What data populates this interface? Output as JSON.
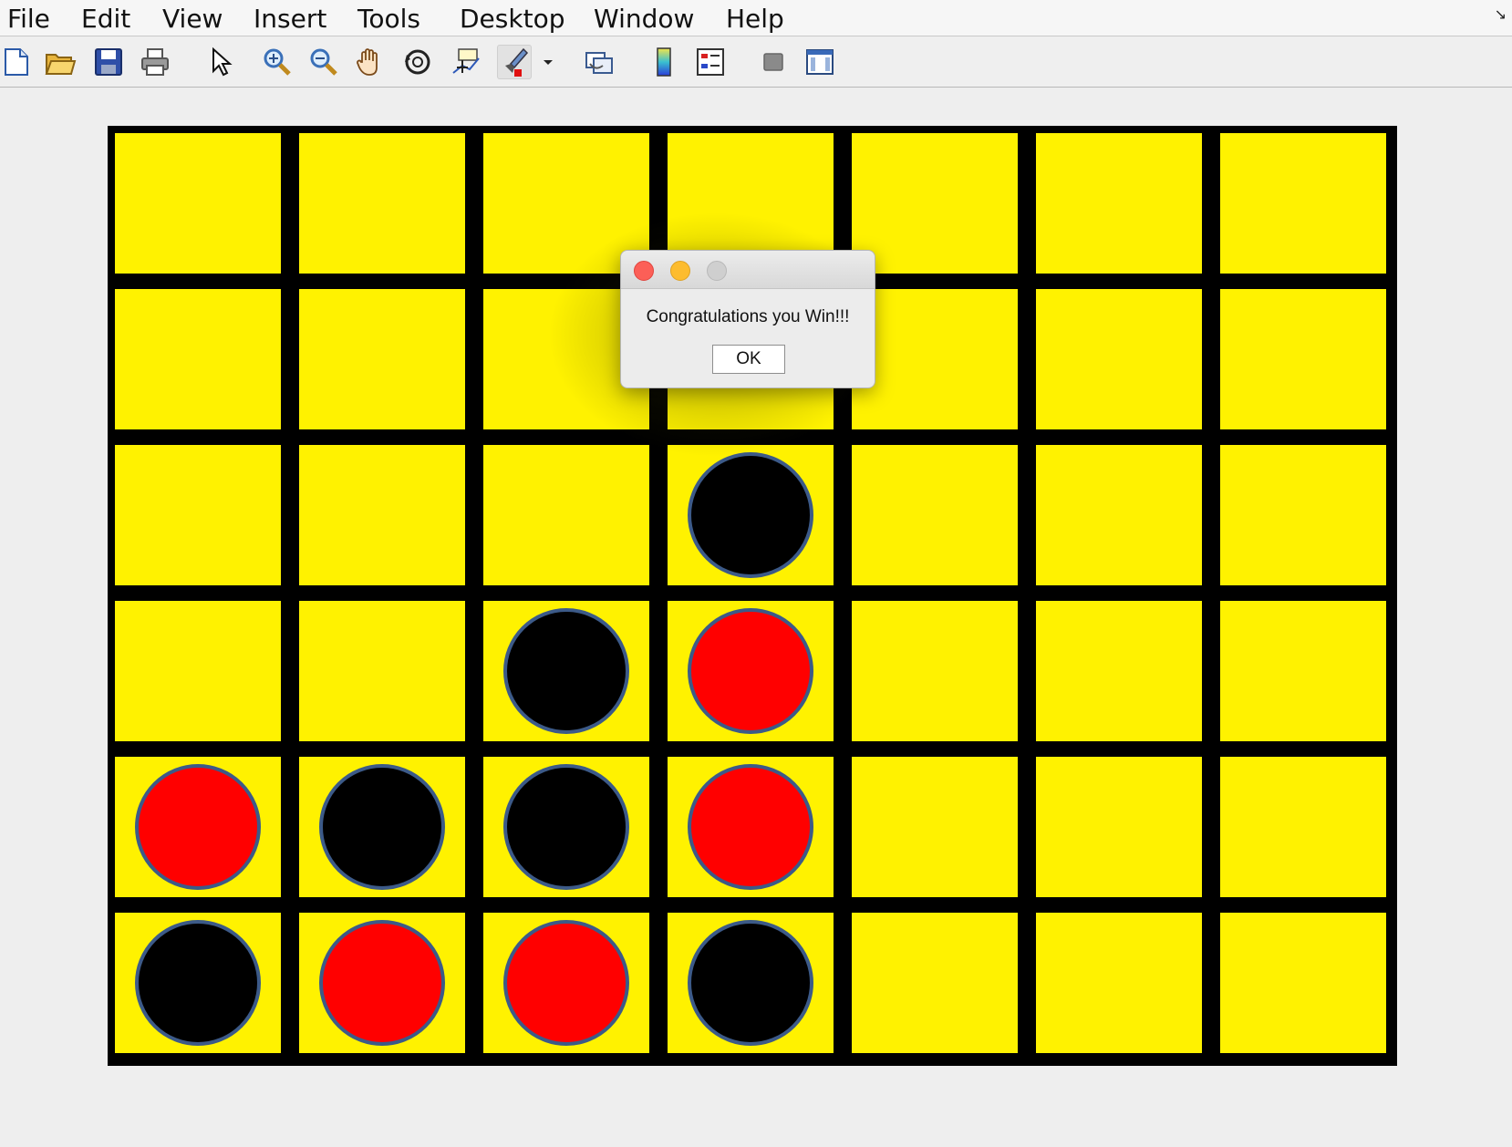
{
  "menu": {
    "items": [
      {
        "id": "file",
        "label": "File"
      },
      {
        "id": "edit",
        "label": "Edit"
      },
      {
        "id": "view",
        "label": "View"
      },
      {
        "id": "insert",
        "label": "Insert"
      },
      {
        "id": "tools",
        "label": "Tools"
      },
      {
        "id": "desktop",
        "label": "Desktop"
      },
      {
        "id": "window",
        "label": "Window"
      },
      {
        "id": "help",
        "label": "Help"
      }
    ]
  },
  "toolbar": {
    "icons": [
      "new-figure-icon",
      "open-file-icon",
      "save-icon",
      "print-icon",
      "edit-plot-arrow-icon",
      "zoom-in-icon",
      "zoom-out-icon",
      "pan-hand-icon",
      "rotate-3d-icon",
      "data-cursor-icon",
      "brush-icon",
      "brush-dropdown-icon",
      "link-plot-icon",
      "insert-colorbar-icon",
      "insert-legend-icon",
      "hide-plot-tools-icon",
      "show-plot-tools-icon"
    ]
  },
  "colors": {
    "board_frame": "#000000",
    "cell_yellow": "#fff200",
    "red_disc": "#ff0000",
    "black_disc": "#000000",
    "disc_outline": "#3c5a88"
  },
  "board": {
    "rows": 6,
    "cols": 7,
    "grid": [
      [
        "",
        "",
        "",
        "",
        "",
        "",
        ""
      ],
      [
        "",
        "",
        "",
        "",
        "",
        "",
        ""
      ],
      [
        "",
        "",
        "",
        "black",
        "",
        "",
        ""
      ],
      [
        "",
        "",
        "black",
        "red",
        "",
        "",
        ""
      ],
      [
        "red",
        "black",
        "black",
        "red",
        "",
        "",
        ""
      ],
      [
        "black",
        "red",
        "red",
        "black",
        "",
        "",
        ""
      ]
    ]
  },
  "dialog": {
    "message": "Congratulations you Win!!!",
    "ok_label": "OK"
  }
}
